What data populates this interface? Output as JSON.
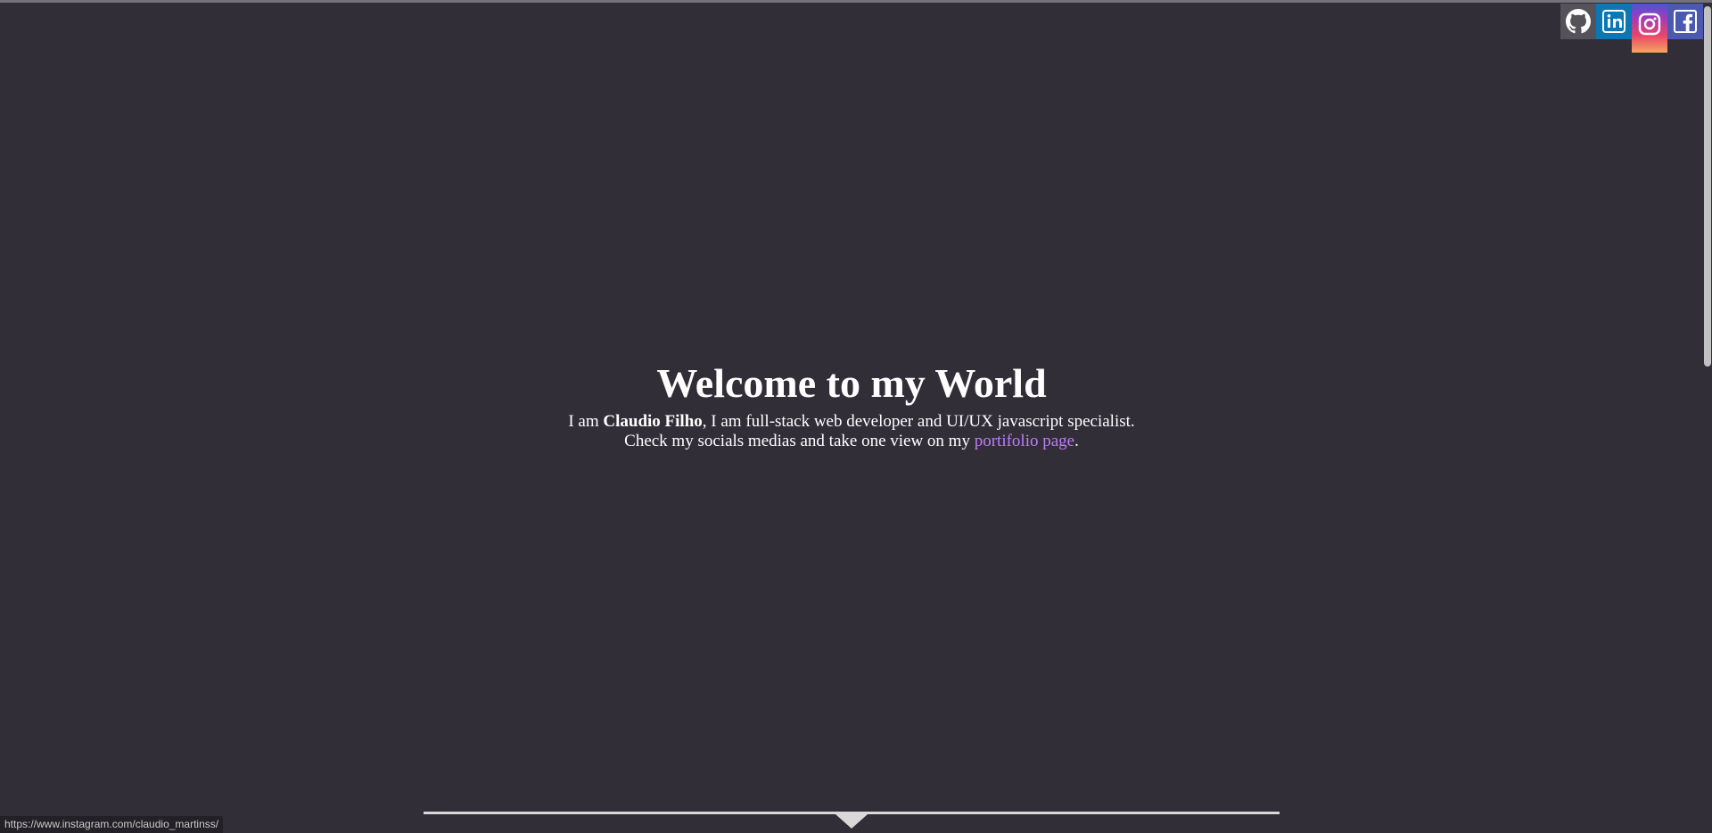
{
  "colors": {
    "background": "#312e38",
    "link": "#bd7ff5",
    "github": "#555259",
    "linkedin": "#0b77b5",
    "facebook": "#4b5ab0"
  },
  "socials": [
    {
      "name": "github",
      "icon": "github-icon"
    },
    {
      "name": "linkedin",
      "icon": "linkedin-icon"
    },
    {
      "name": "instagram",
      "icon": "instagram-icon"
    },
    {
      "name": "facebook",
      "icon": "facebook-icon"
    }
  ],
  "hero": {
    "title": "Welcome to my World",
    "intro_prefix": "I am ",
    "name": "Claudio Filho",
    "intro_suffix": ", I am full-stack web developer and UI/UX javascript specialist.",
    "line2_prefix": "Check my socials medias and take one view on my ",
    "portfolio_link": "portifolio page",
    "line2_suffix": "."
  },
  "status_bar": {
    "url": "https://www.instagram.com/claudio_martinss/"
  }
}
